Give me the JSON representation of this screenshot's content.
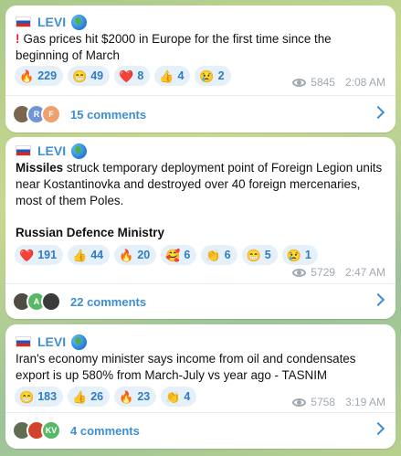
{
  "colors": {
    "accent": "#3d8fd1",
    "chip_bg": "#e6f0f9",
    "meta_gray": "#a1a9b0"
  },
  "posts": [
    {
      "author": "LEVI",
      "text": "Gas prices hit $2000 in Europe for the first time since the beginning of March",
      "reactions": [
        {
          "emoji": "🔥",
          "count": "229"
        },
        {
          "emoji": "😁",
          "count": "49"
        },
        {
          "emoji": "❤️",
          "count": "8"
        },
        {
          "emoji": "👍",
          "count": "4"
        },
        {
          "emoji": "😢",
          "count": "2"
        }
      ],
      "views": "5845",
      "time": "2:08 AM",
      "avatars": [
        "",
        "R",
        "F"
      ],
      "comments_label": "15 comments"
    },
    {
      "author": "LEVI",
      "text_bold": "Missiles",
      "text_rest": "struck temporary deployment point of Foreign Legion units near Kostantinovka and destroyed over 40 foreign mercenaries, most of them Poles.",
      "source": "Russian Defence Ministry",
      "reactions": [
        {
          "emoji": "❤️",
          "count": "191"
        },
        {
          "emoji": "👍",
          "count": "44"
        },
        {
          "emoji": "🔥",
          "count": "20"
        },
        {
          "emoji": "🥰",
          "count": "6"
        },
        {
          "emoji": "👏",
          "count": "6"
        },
        {
          "emoji": "😁",
          "count": "5"
        },
        {
          "emoji": "😢",
          "count": "1"
        }
      ],
      "views": "5729",
      "time": "2:47 AM",
      "avatars": [
        "",
        "A",
        ""
      ],
      "comments_label": "22 comments"
    },
    {
      "author": "LEVI",
      "text": "Iran's economy minister says income from oil and condensates export is up 580% from March-July vs year ago - TASNIM",
      "reactions": [
        {
          "emoji": "😁",
          "count": "183"
        },
        {
          "emoji": "👍",
          "count": "26"
        },
        {
          "emoji": "🔥",
          "count": "23"
        },
        {
          "emoji": "👏",
          "count": "4"
        }
      ],
      "views": "5758",
      "time": "3:19 AM",
      "avatars": [
        "",
        "",
        "KV"
      ],
      "comments_label": "4 comments"
    }
  ]
}
